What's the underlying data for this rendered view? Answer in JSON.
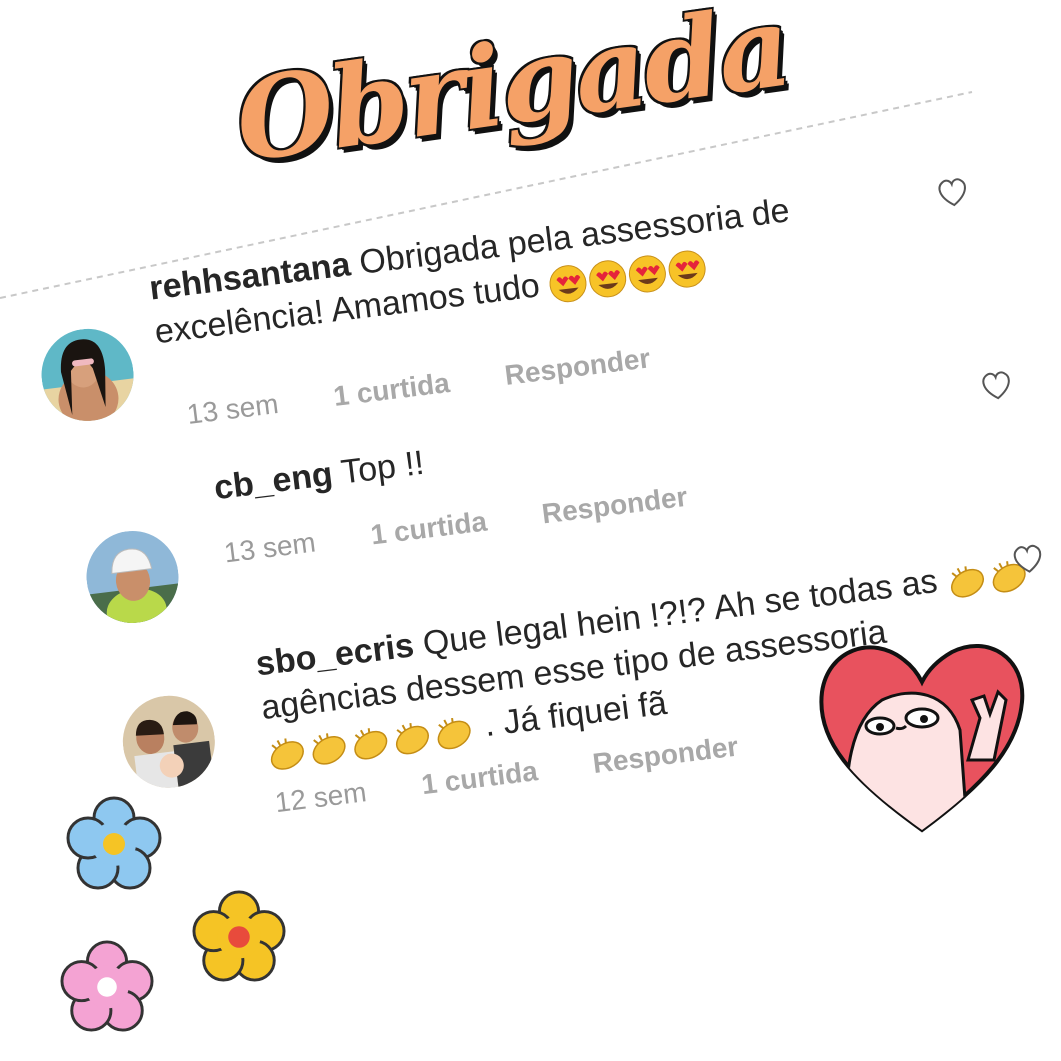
{
  "title": "Obrigada",
  "comments": [
    {
      "username": "rehhsantana",
      "text": "Obrigada pela assessoria de excelência! Amamos tudo",
      "emoji_icon": "heart-eyes-emoji",
      "emoji_count": 4,
      "time": "13 sem",
      "likes": "1 curtida",
      "reply": "Responder"
    },
    {
      "username": "cb_eng",
      "text": "Top !!",
      "time": "13 sem",
      "likes": "1 curtida",
      "reply": "Responder"
    },
    {
      "username": "sbo_ecris",
      "text_line1": "Que legal hein !?!? Ah se todas as",
      "text_line2": "agências dessem esse tipo de assessoria",
      "text_line3": ". Já fiquei fã",
      "emoji_icon": "clapping-hands-emoji",
      "time": "12 sem",
      "likes": "1 curtida",
      "reply": "Responder"
    }
  ],
  "colors": {
    "title_fill": "#f5a167",
    "text": "#262626",
    "meta": "#9a9a9a",
    "heart_sticker": "#e8525e",
    "flower_blue": "#8ec8f0",
    "flower_yellow": "#f5c425",
    "flower_pink": "#f4a3d3"
  }
}
